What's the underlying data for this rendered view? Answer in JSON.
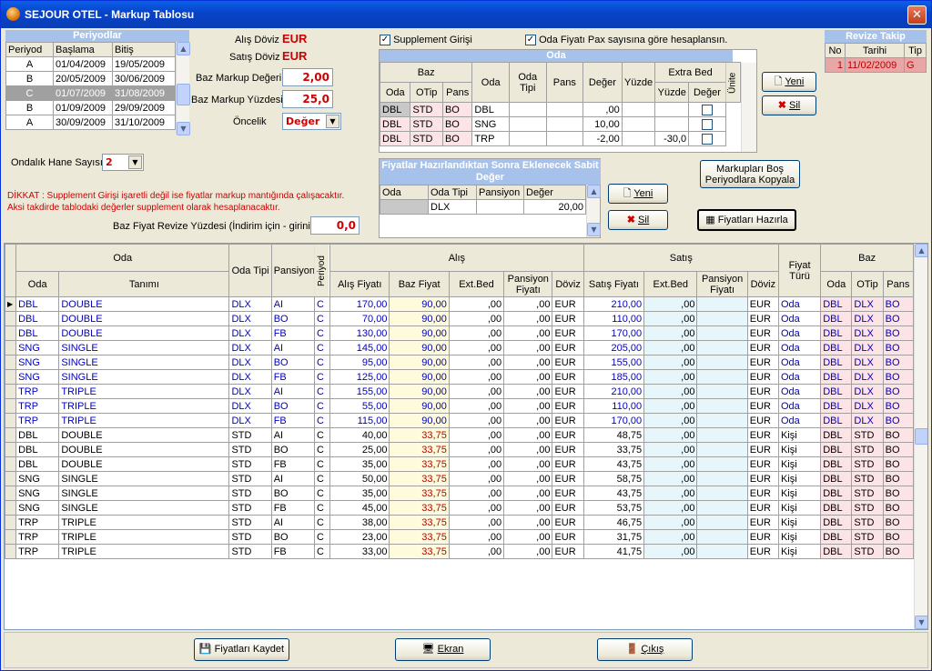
{
  "window": {
    "title": "SEJOUR OTEL - Markup Tablosu",
    "close": "✕"
  },
  "periodlar": {
    "title": "Periyodlar",
    "headers": [
      "Periyod",
      "Başlama",
      "Bitiş"
    ],
    "rows": [
      [
        "A",
        "01/04/2009",
        "19/05/2009"
      ],
      [
        "B",
        "20/05/2009",
        "30/06/2009"
      ],
      [
        "C",
        "01/07/2009",
        "31/08/2009"
      ],
      [
        "B",
        "01/09/2009",
        "29/09/2009"
      ],
      [
        "A",
        "30/09/2009",
        "31/10/2009"
      ]
    ]
  },
  "form": {
    "alis_doviz_label": "Alış Döviz",
    "alis_doviz": "EUR",
    "satis_doviz_label": "Satış Döviz",
    "satis_doviz": "EUR",
    "baz_markup_degeri_label": "Baz Markup Değeri",
    "baz_markup_degeri": "2,00",
    "baz_markup_yuzdesi_label": "Baz Markup Yüzdesi",
    "baz_markup_yuzdesi": "25,0",
    "oncelik_label": "Öncelik",
    "oncelik": "Değer",
    "ondalik_label": "Ondalık Hane Sayısı",
    "ondalik": "2",
    "dikkat": "DİKKAT : Supplement Girişi işaretli değil ise fiyatlar markup mantığında çalışacaktır.",
    "dikkat2": "Aksi takdirde tablodaki değerler supplement olarak hesaplanacaktır.",
    "revize_label": "Baz Fiyat Revize Yüzdesi (İndirim için - giriniz)",
    "revize": "0,0"
  },
  "checks": {
    "supplement": "Supplement Girişi",
    "pax": "Oda Fiyatı Pax sayısına göre hesaplansın.",
    "checkmark": "✓"
  },
  "oda": {
    "title": "Oda",
    "baz": "Baz",
    "h_oda": "Oda",
    "h_otip": "OTip",
    "h_pans": "Pans",
    "h_oda2": "Oda",
    "h_odatipi": "Oda Tipi",
    "h_pans2": "Pans",
    "h_deger": "Değer",
    "h_yuzde": "Yüzde",
    "extra": "Extra Bed",
    "h_eyuzde": "Yüzde",
    "h_edeger": "Değer",
    "h_unite": "Ünite",
    "rows": [
      [
        "DBL",
        "STD",
        "BO",
        "DBL",
        "",
        "",
        ",00",
        "",
        "",
        ""
      ],
      [
        "DBL",
        "STD",
        "BO",
        "SNG",
        "",
        "",
        "10,00",
        "",
        "",
        ""
      ],
      [
        "DBL",
        "STD",
        "BO",
        "TRP",
        "",
        "",
        "-2,00",
        "",
        "-30,0",
        ""
      ]
    ]
  },
  "sabit": {
    "title": "Fiyatlar Hazırlandıktan Sonra Eklenecek Sabit Değer",
    "headers": [
      "Oda",
      "Oda Tipi",
      "Pansiyon",
      "Değer"
    ],
    "row": [
      "",
      "DLX",
      "",
      "20,00"
    ]
  },
  "buttons": {
    "yeni": "Yeni",
    "sil": "Sil",
    "yeni2": "Yeni",
    "sil2": "Sil",
    "kopyala": "Markupları Boş Periyodlara Kopyala",
    "hazirla": "Fiyatları Hazırla",
    "kaydet": "Fiyatları Kaydet",
    "ekran": "Ekran",
    "cikis": "Çıkış"
  },
  "revize_takip": {
    "title": "Revize Takip",
    "headers": [
      "No",
      "Tarihi",
      "Tip"
    ],
    "row": [
      "1",
      "11/02/2009",
      "G"
    ]
  },
  "main": {
    "h_oda": "Oda",
    "h_oda_sub": "Oda",
    "h_tanimi": "Tanımı",
    "h_odatipi": "Oda Tipi",
    "h_pansiyon": "Pansiyon",
    "h_periyod": "Periyod",
    "h_alis": "Alış",
    "h_satis": "Satış",
    "h_fiyat_turu": "Fiyat Türü",
    "h_baz": "Baz",
    "h_alis_fiyati": "Alış Fiyatı",
    "h_baz_fiyat": "Baz Fiyat",
    "h_extbed": "Ext.Bed",
    "h_pans_fiyati": "Pansiyon Fiyatı",
    "h_doviz": "Döviz",
    "h_satis_fiyati": "Satış Fiyatı",
    "h_extbed2": "Ext.Bed",
    "h_pans_fiyati2": "Pansiyon Fiyatı",
    "h_doviz2": "Döviz",
    "h_boda": "Oda",
    "h_botip": "OTip",
    "h_bpans": "Pans",
    "rows": [
      [
        "DBL",
        "DOUBLE",
        "DLX",
        "AI",
        "C",
        "170,00",
        "90,00",
        ",00",
        ",00",
        "EUR",
        "210,00",
        ",00",
        "",
        "EUR",
        "Oda",
        "DBL",
        "DLX",
        "BO"
      ],
      [
        "DBL",
        "DOUBLE",
        "DLX",
        "BO",
        "C",
        "70,00",
        "90,00",
        ",00",
        ",00",
        "EUR",
        "110,00",
        ",00",
        "",
        "EUR",
        "Oda",
        "DBL",
        "DLX",
        "BO"
      ],
      [
        "DBL",
        "DOUBLE",
        "DLX",
        "FB",
        "C",
        "130,00",
        "90,00",
        ",00",
        ",00",
        "EUR",
        "170,00",
        ",00",
        "",
        "EUR",
        "Oda",
        "DBL",
        "DLX",
        "BO"
      ],
      [
        "SNG",
        "SINGLE",
        "DLX",
        "AI",
        "C",
        "145,00",
        "90,00",
        ",00",
        ",00",
        "EUR",
        "205,00",
        ",00",
        "",
        "EUR",
        "Oda",
        "DBL",
        "DLX",
        "BO"
      ],
      [
        "SNG",
        "SINGLE",
        "DLX",
        "BO",
        "C",
        "95,00",
        "90,00",
        ",00",
        ",00",
        "EUR",
        "155,00",
        ",00",
        "",
        "EUR",
        "Oda",
        "DBL",
        "DLX",
        "BO"
      ],
      [
        "SNG",
        "SINGLE",
        "DLX",
        "FB",
        "C",
        "125,00",
        "90,00",
        ",00",
        ",00",
        "EUR",
        "185,00",
        ",00",
        "",
        "EUR",
        "Oda",
        "DBL",
        "DLX",
        "BO"
      ],
      [
        "TRP",
        "TRIPLE",
        "DLX",
        "AI",
        "C",
        "155,00",
        "90,00",
        ",00",
        ",00",
        "EUR",
        "210,00",
        ",00",
        "",
        "EUR",
        "Oda",
        "DBL",
        "DLX",
        "BO"
      ],
      [
        "TRP",
        "TRIPLE",
        "DLX",
        "BO",
        "C",
        "55,00",
        "90,00",
        ",00",
        ",00",
        "EUR",
        "110,00",
        ",00",
        "",
        "EUR",
        "Oda",
        "DBL",
        "DLX",
        "BO"
      ],
      [
        "TRP",
        "TRIPLE",
        "DLX",
        "FB",
        "C",
        "115,00",
        "90,00",
        ",00",
        ",00",
        "EUR",
        "170,00",
        ",00",
        "",
        "EUR",
        "Oda",
        "DBL",
        "DLX",
        "BO"
      ],
      [
        "DBL",
        "DOUBLE",
        "STD",
        "AI",
        "C",
        "40,00",
        "33,75",
        ",00",
        ",00",
        "EUR",
        "48,75",
        ",00",
        "",
        "EUR",
        "Kişi",
        "DBL",
        "STD",
        "BO"
      ],
      [
        "DBL",
        "DOUBLE",
        "STD",
        "BO",
        "C",
        "25,00",
        "33,75",
        ",00",
        ",00",
        "EUR",
        "33,75",
        ",00",
        "",
        "EUR",
        "Kişi",
        "DBL",
        "STD",
        "BO"
      ],
      [
        "DBL",
        "DOUBLE",
        "STD",
        "FB",
        "C",
        "35,00",
        "33,75",
        ",00",
        ",00",
        "EUR",
        "43,75",
        ",00",
        "",
        "EUR",
        "Kişi",
        "DBL",
        "STD",
        "BO"
      ],
      [
        "SNG",
        "SINGLE",
        "STD",
        "AI",
        "C",
        "50,00",
        "33,75",
        ",00",
        ",00",
        "EUR",
        "58,75",
        ",00",
        "",
        "EUR",
        "Kişi",
        "DBL",
        "STD",
        "BO"
      ],
      [
        "SNG",
        "SINGLE",
        "STD",
        "BO",
        "C",
        "35,00",
        "33,75",
        ",00",
        ",00",
        "EUR",
        "43,75",
        ",00",
        "",
        "EUR",
        "Kişi",
        "DBL",
        "STD",
        "BO"
      ],
      [
        "SNG",
        "SINGLE",
        "STD",
        "FB",
        "C",
        "45,00",
        "33,75",
        ",00",
        ",00",
        "EUR",
        "53,75",
        ",00",
        "",
        "EUR",
        "Kişi",
        "DBL",
        "STD",
        "BO"
      ],
      [
        "TRP",
        "TRIPLE",
        "STD",
        "AI",
        "C",
        "38,00",
        "33,75",
        ",00",
        ",00",
        "EUR",
        "46,75",
        ",00",
        "",
        "EUR",
        "Kişi",
        "DBL",
        "STD",
        "BO"
      ],
      [
        "TRP",
        "TRIPLE",
        "STD",
        "BO",
        "C",
        "23,00",
        "33,75",
        ",00",
        ",00",
        "EUR",
        "31,75",
        ",00",
        "",
        "EUR",
        "Kişi",
        "DBL",
        "STD",
        "BO"
      ],
      [
        "TRP",
        "TRIPLE",
        "STD",
        "FB",
        "C",
        "33,00",
        "33,75",
        ",00",
        ",00",
        "EUR",
        "41,75",
        ",00",
        "",
        "EUR",
        "Kişi",
        "DBL",
        "STD",
        "BO"
      ]
    ]
  }
}
